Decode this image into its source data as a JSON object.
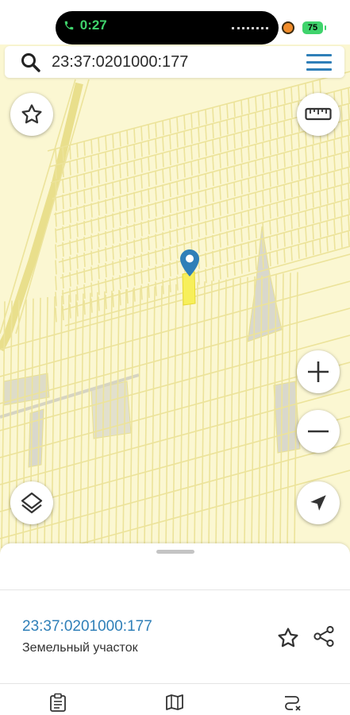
{
  "status_bar": {
    "call_time": "0:27",
    "battery": "75"
  },
  "search": {
    "query": "23:37:0201000:177",
    "icon": "search-icon",
    "menu_icon": "hamburger-menu-icon"
  },
  "map": {
    "controls": {
      "favorite_icon": "star-outline-icon",
      "ruler_icon": "ruler-icon",
      "zoom_in_icon": "plus-icon",
      "zoom_out_icon": "minus-icon",
      "layers_icon": "layers-icon",
      "location_icon": "navigation-arrow-icon"
    },
    "selected_marker_icon": "location-pin-icon",
    "colors": {
      "background": "#fbf7d2",
      "parcel_line": "#ece39a",
      "gray_parcel": "#d9d8cc",
      "selected_parcel": "#f7ef5a",
      "accent": "#2f7fb8"
    }
  },
  "parcel_card": {
    "cadastral_number": "23:37:0201000:177",
    "type": "Земельный участок",
    "favorite_icon": "star-outline-icon",
    "share_icon": "share-icon"
  },
  "bottom_tabs": [
    {
      "icon": "clipboard-icon"
    },
    {
      "icon": "map-icon"
    },
    {
      "icon": "route-icon"
    }
  ]
}
